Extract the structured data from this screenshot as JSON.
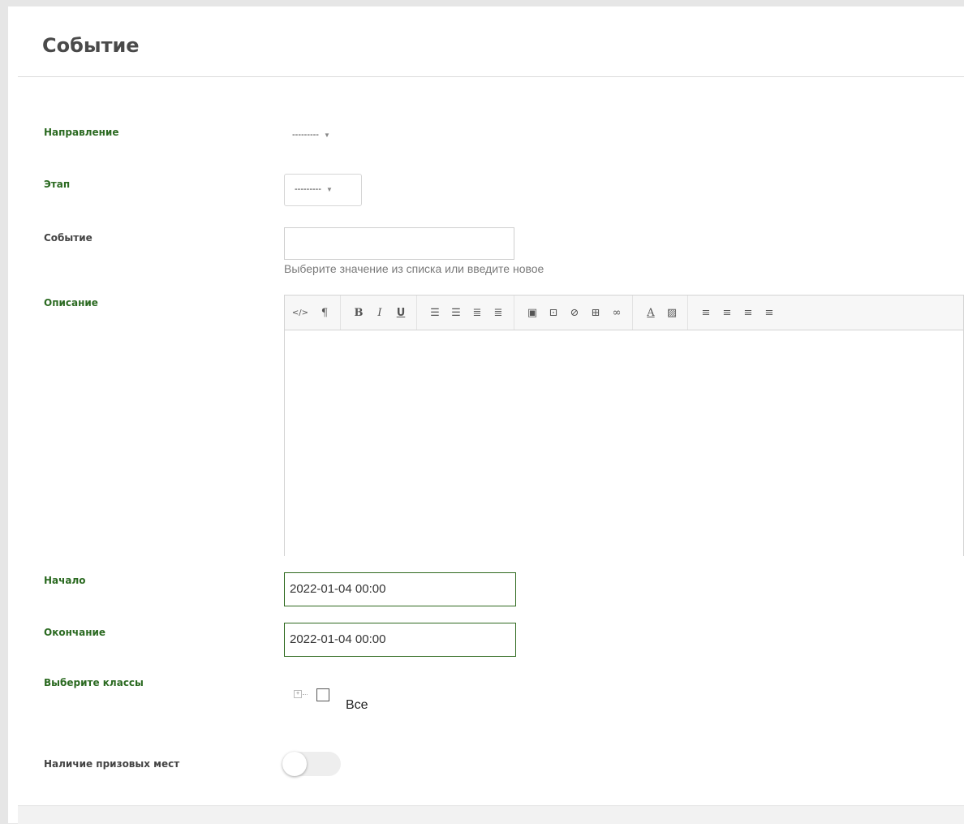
{
  "panel": {
    "title": "Событие"
  },
  "fields": {
    "direction": {
      "label": "Направление",
      "value": "---------"
    },
    "stage": {
      "label": "Этап",
      "value": "---------"
    },
    "event": {
      "label": "Событие",
      "value": "",
      "hint": "Выберите значение из списка или введите новое"
    },
    "description": {
      "label": "Описание",
      "toolbar": [
        "html-icon",
        "paragraph-icon",
        "bold-icon",
        "italic-icon",
        "underline-icon",
        "unordered-list-icon",
        "ordered-list-icon",
        "outdent-icon",
        "indent-icon",
        "image-icon",
        "video-icon",
        "file-icon",
        "table-icon",
        "link-icon",
        "font-color-icon",
        "background-color-icon",
        "align-left-icon",
        "align-center-icon",
        "align-right-icon",
        "justify-icon"
      ]
    },
    "start": {
      "label": "Начало",
      "value": "2022-01-04 00:00"
    },
    "end": {
      "label": "Окончание",
      "value": "2022-01-04 00:00"
    },
    "classes": {
      "label": "Выберите классы",
      "tree_root": "Все",
      "checked": false
    },
    "prizes": {
      "label": "Наличие призовых мест",
      "enabled": false
    }
  },
  "colors": {
    "label_green": "#2b6a21",
    "date_border": "#2f6a1f"
  }
}
